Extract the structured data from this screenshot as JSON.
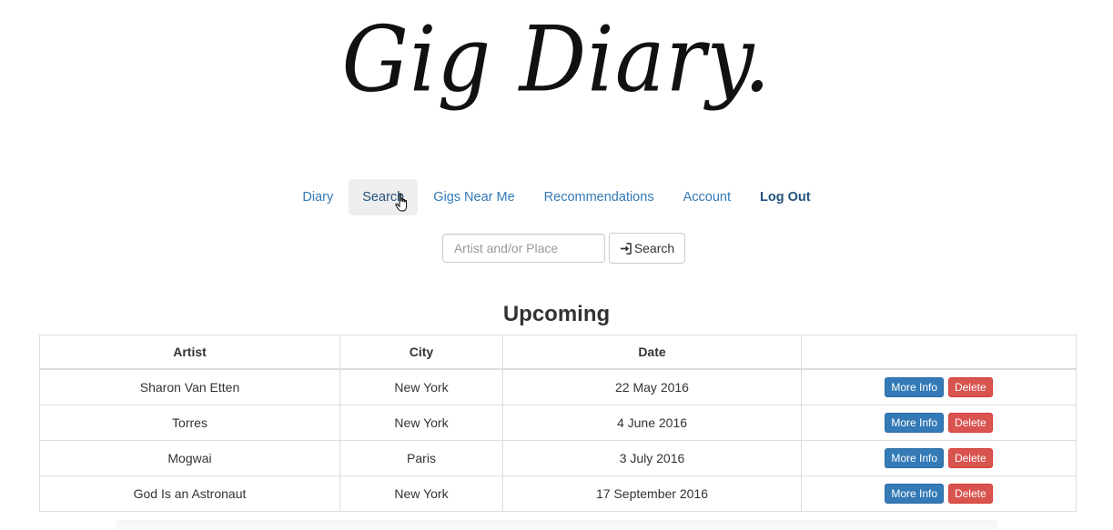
{
  "brand": {
    "title": "Gig Diary."
  },
  "nav": {
    "items": [
      {
        "label": "Diary"
      },
      {
        "label": "Search"
      },
      {
        "label": "Gigs Near Me"
      },
      {
        "label": "Recommendations"
      },
      {
        "label": "Account"
      },
      {
        "label": "Log Out"
      }
    ],
    "active": "Search"
  },
  "search": {
    "placeholder": "Artist and/or Place",
    "value": "",
    "button_label": "Search",
    "button_icon": "sign-in-icon"
  },
  "upcoming": {
    "title": "Upcoming",
    "columns": [
      "Artist",
      "City",
      "Date",
      ""
    ],
    "rows": [
      {
        "artist": "Sharon Van Etten",
        "city": "New York",
        "date": "22 May 2016",
        "more_label": "More Info",
        "delete_label": "Delete"
      },
      {
        "artist": "Torres",
        "city": "New York",
        "date": "4 June 2016",
        "more_label": "More Info",
        "delete_label": "Delete"
      },
      {
        "artist": "Mogwai",
        "city": "Paris",
        "date": "3 July 2016",
        "more_label": "More Info",
        "delete_label": "Delete"
      },
      {
        "artist": "God Is an Astronaut",
        "city": "New York",
        "date": "17 September 2016",
        "more_label": "More Info",
        "delete_label": "Delete"
      }
    ]
  },
  "colors": {
    "link": "#337ab7",
    "info_button": "#337ab7",
    "delete_button": "#d9534f",
    "active_nav_bg": "#eeeeee"
  }
}
